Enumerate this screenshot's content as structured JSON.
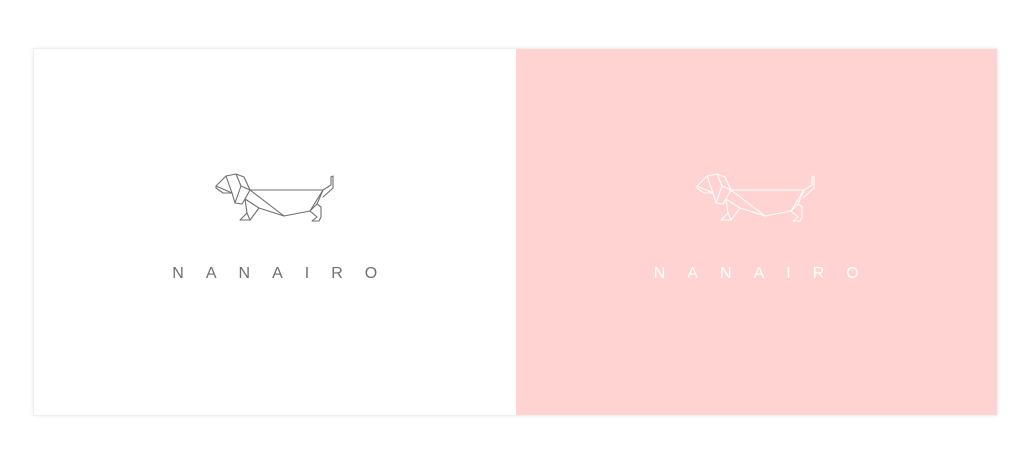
{
  "brand": {
    "wordmark": "NANAIRO",
    "dog_icon": "origami-dachshund-icon"
  },
  "panels": [
    {
      "variant": "light",
      "background": "#ffffff",
      "ink": "#6f6f6f"
    },
    {
      "variant": "pink",
      "background": "#fed3d2",
      "ink": "#ffffff"
    }
  ]
}
